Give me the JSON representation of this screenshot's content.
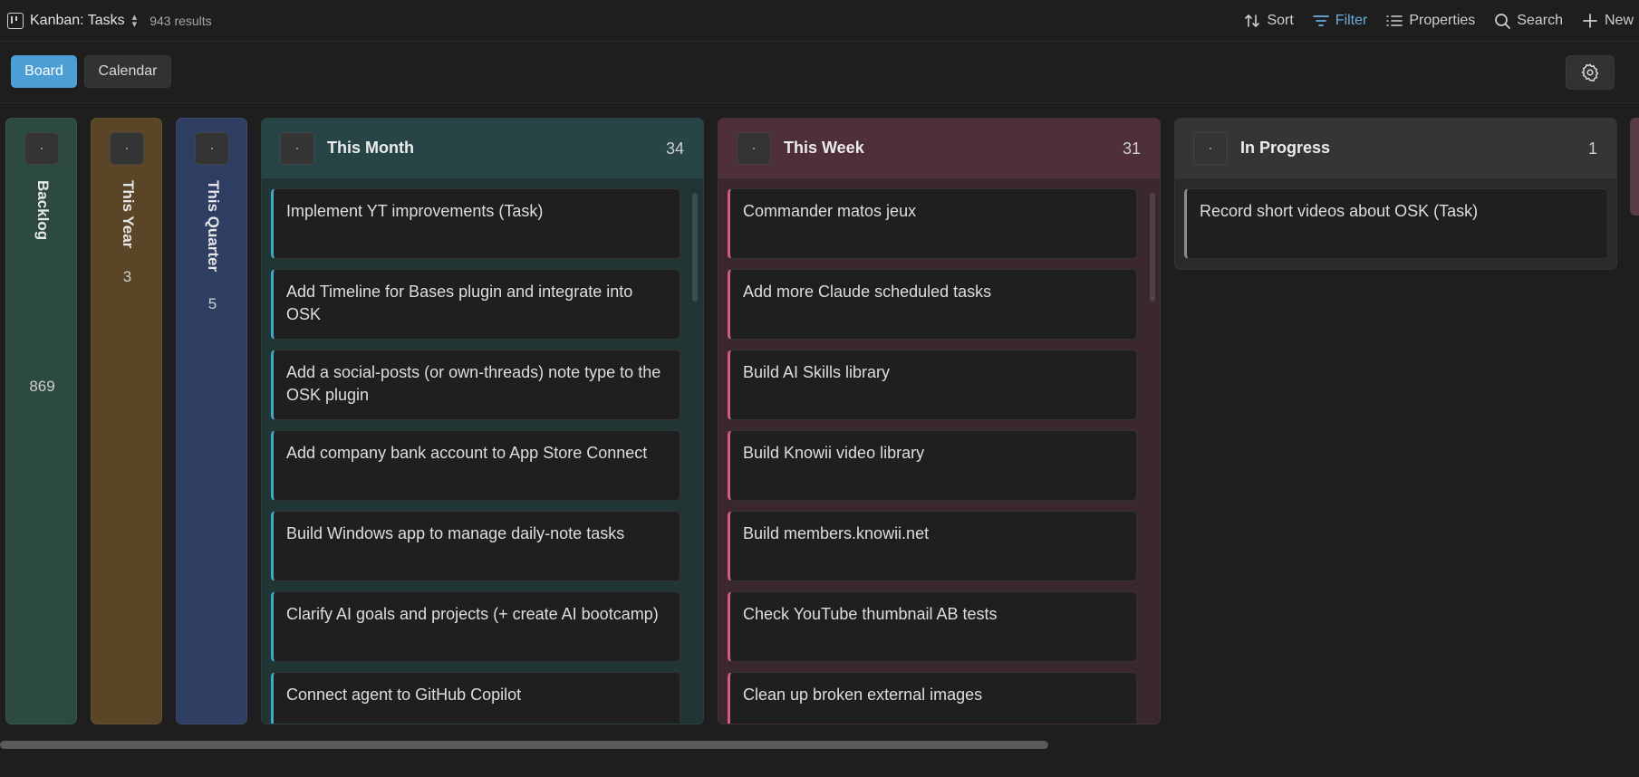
{
  "toolbar": {
    "view_title": "Kanban: Tasks",
    "results": "943 results",
    "actions": {
      "sort": "Sort",
      "filter": "Filter",
      "properties": "Properties",
      "search": "Search",
      "new": "New"
    }
  },
  "tabs": {
    "board": "Board",
    "calendar": "Calendar"
  },
  "collapsed_columns": [
    {
      "title": "Backlog",
      "count": "869",
      "color": "#2c4a3d"
    },
    {
      "title": "This Year",
      "count": "3",
      "color": "#5a4526"
    },
    {
      "title": "This Quarter",
      "count": "5",
      "color": "#2f3f63"
    }
  ],
  "columns": [
    {
      "title": "This Month",
      "count": "34",
      "header_color": "#274546",
      "body_color": "#223535",
      "accent": "#3fa8c8",
      "cards": [
        "Implement YT improvements (Task)",
        "Add Timeline for Bases plugin and integrate into OSK",
        "Add a social-posts (or own-threads) note type to the OSK plugin",
        "Add company bank account to App Store Connect",
        "Build Windows app to manage daily-note tasks",
        "Clarify AI goals and projects (+ create AI bootcamp)",
        "Connect agent to GitHub Copilot"
      ]
    },
    {
      "title": "This Week",
      "count": "31",
      "header_color": "#4e2f3a",
      "body_color": "#3a2730",
      "accent": "#d45a8a",
      "cards": [
        "Commander matos jeux",
        "Add more Claude scheduled tasks",
        "Build AI Skills library",
        "Build Knowii video library",
        "Build members.knowii.net",
        "Check YouTube thumbnail AB tests",
        "Clean up broken external images"
      ]
    },
    {
      "title": "In Progress",
      "count": "1",
      "header_color": "#353535",
      "body_color": "#2a2a2a",
      "accent": "#8a8a8a",
      "cards": [
        "Record short videos about OSK (Task)"
      ]
    }
  ]
}
